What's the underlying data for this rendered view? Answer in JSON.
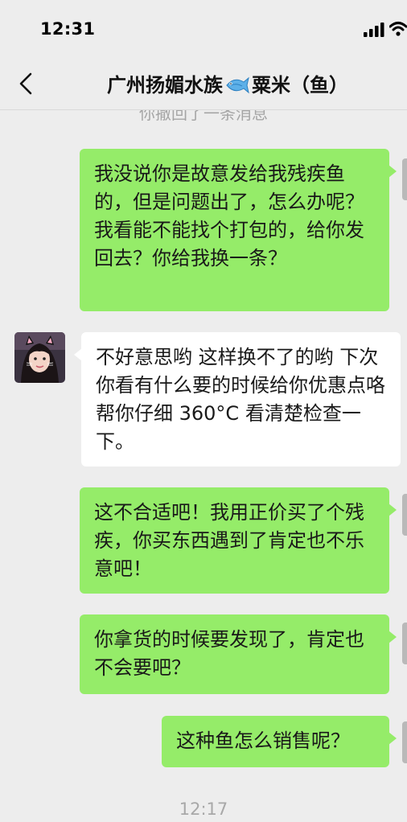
{
  "status_bar": {
    "time": "12:31",
    "icons": [
      "signal-icon",
      "wifi-icon"
    ]
  },
  "header": {
    "title_prefix": "广州扬媚水族",
    "title_icon": "fish-emoji-icon",
    "title_suffix": "粟米（鱼）",
    "back_icon": "chevron-left-icon"
  },
  "chat": {
    "recall_notice": "你撤回了一条消息",
    "messages": [
      {
        "sender": "self",
        "text": "我没说你是故意发给我残疾鱼的，但是问题出了，怎么办呢？我看能不能找个打包的，给你发回去？你给我换一条？"
      },
      {
        "sender": "peer",
        "text": "不好意思哟 这样换不了的哟 下次你看有什么要的时候给你优惠点咯 帮你仔细 360°C 看清楚检查一下。"
      },
      {
        "sender": "self",
        "text": "这不合适吧！我用正价买了个残疾，你买东西遇到了肯定也不乐意吧！"
      },
      {
        "sender": "self",
        "text": "你拿货的时候要发现了，肯定也不会要吧？"
      },
      {
        "sender": "self",
        "text": "这种鱼怎么销售呢？"
      }
    ],
    "timestamp": "12:17"
  },
  "colors": {
    "background": "#ededed",
    "self_bubble": "#95ec69",
    "peer_bubble": "#ffffff"
  }
}
